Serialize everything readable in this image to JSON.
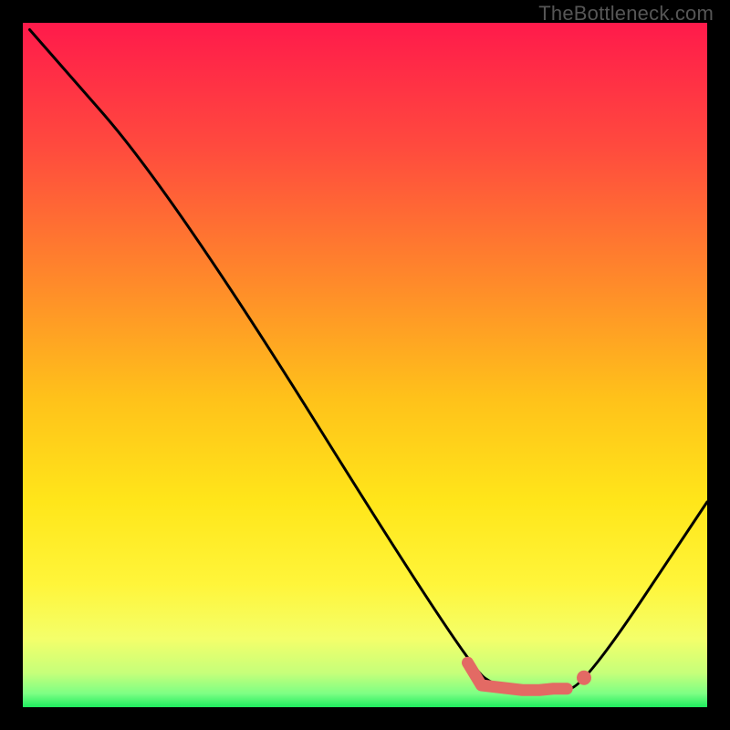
{
  "watermark": "TheBottleneck.com",
  "chart_data": {
    "type": "line",
    "title": "",
    "xlabel": "",
    "ylabel": "",
    "xlim": [
      0,
      100
    ],
    "ylim": [
      0,
      100
    ],
    "curve": [
      {
        "x": 1,
        "y": 99
      },
      {
        "x": 22,
        "y": 75
      },
      {
        "x": 65,
        "y": 6
      },
      {
        "x": 70,
        "y": 2.5
      },
      {
        "x": 78,
        "y": 2.5
      },
      {
        "x": 82,
        "y": 3
      },
      {
        "x": 100,
        "y": 30
      }
    ],
    "optimal_marker": [
      {
        "x": 65,
        "y": 6.5
      },
      {
        "x": 67,
        "y": 3.2
      },
      {
        "x": 73,
        "y": 2.5
      },
      {
        "x": 75.5,
        "y": 2.5
      },
      {
        "x": 77.5,
        "y": 2.7
      },
      {
        "x": 79.5,
        "y": 2.7
      }
    ],
    "dashes": [
      [
        0,
        3
      ],
      [
        3,
        5
      ]
    ],
    "dash_width": 13,
    "dash_color": "#e36a64",
    "dot": {
      "x": 82,
      "y": 4.3,
      "r": 8,
      "color": "#e36a64"
    },
    "gradient_stops": [
      {
        "offset": 0,
        "color": "#ff1a4b"
      },
      {
        "offset": 18,
        "color": "#ff4a3e"
      },
      {
        "offset": 38,
        "color": "#ff8a2a"
      },
      {
        "offset": 55,
        "color": "#ffc21a"
      },
      {
        "offset": 70,
        "color": "#ffe61a"
      },
      {
        "offset": 82,
        "color": "#fff53a"
      },
      {
        "offset": 90,
        "color": "#f4ff6a"
      },
      {
        "offset": 95,
        "color": "#c6ff7a"
      },
      {
        "offset": 98,
        "color": "#7dff84"
      },
      {
        "offset": 100,
        "color": "#1eec5e"
      }
    ]
  }
}
